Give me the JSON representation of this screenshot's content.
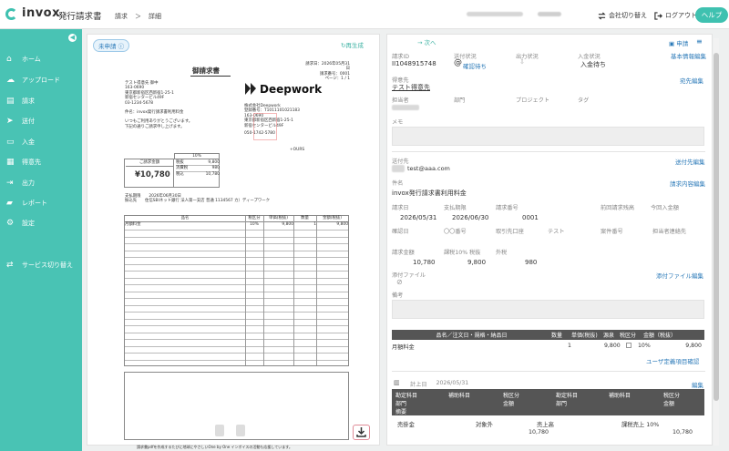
{
  "header": {
    "logo": "invox",
    "subtitle": "発行請求書",
    "breadcrumb": [
      "請求",
      "＞",
      "詳細"
    ],
    "switch_company": "会社切り替え",
    "logout": "ログアウト",
    "help": "ヘルプ"
  },
  "sidebar": {
    "items": [
      {
        "label": "ホーム",
        "icon": "home-icon"
      },
      {
        "label": "アップロード",
        "icon": "cloud-upload-icon"
      },
      {
        "label": "請求",
        "icon": "document-icon"
      },
      {
        "label": "送付",
        "icon": "paper-plane-icon"
      },
      {
        "label": "入金",
        "icon": "wallet-icon"
      },
      {
        "label": "得意先",
        "icon": "building-icon"
      },
      {
        "label": "出力",
        "icon": "export-icon"
      },
      {
        "label": "レポート",
        "icon": "chart-icon"
      },
      {
        "label": "設定",
        "icon": "gear-icon"
      },
      {
        "label": "サービス切り替え",
        "icon": "switch-icon"
      }
    ]
  },
  "doc": {
    "status": "未申請",
    "regenerate": "再生成",
    "title": "御請求書",
    "issue_date": "請求日：2026年05月31日",
    "number": "請求番号：0001",
    "page": "ページ：1 / 1",
    "to_name": "テスト得意先 御中",
    "to_zip": "163-0690",
    "to_addr1": "東京都新宿区西新宿1-25-1",
    "to_addr2": "新宿センタービル49F",
    "to_tel": "03-1234-5678",
    "subject": "件名：invox発行請求書利用料金",
    "greeting1": "いつもご利用ありがとうございます。",
    "greeting2": "下記の通りご請求申し上げます。",
    "brand": "Deepwork",
    "issuer": [
      "株式会社Deepwork",
      "登録番号：T1011101021183",
      "163-0690",
      "東京都新宿区西新宿1-25-1",
      "新宿センタービル49F",
      "050-1742-5780"
    ],
    "tax_rate": "10%",
    "amount_label": "ご請求金額",
    "amount": "¥10,780",
    "tax_rows": [
      [
        "税抜",
        "9,800"
      ],
      [
        "消費税",
        "980"
      ],
      [
        "税込",
        "10,780"
      ]
    ],
    "due": "支払期限",
    "due_date": "2026年06月30日",
    "bank_label": "振込先",
    "bank": "住信SBIネット銀行 法人第一支店 普通 1134567 カ）ディープワーク",
    "cols": [
      "品名",
      "税区分",
      "単価(税抜)",
      "数量",
      "金額(税抜)"
    ],
    "item": [
      "月額料金",
      "10%",
      "9,800",
      "1",
      "9,800"
    ],
    "footer_note": "請求書pdfを作成するたびに地球にやさしいOne by One インボイスの活動も応援しています。"
  },
  "right": {
    "next": "次へ",
    "apply": "申請",
    "fields1_labels": [
      "請求ID",
      "送付状況",
      "出力状況",
      "入金状況"
    ],
    "invoice_id": "II1048915748",
    "send_status": "確認待ち",
    "deposit_status": "入金待ち",
    "basic_edit": "基本情報編集",
    "customer_label": "得意先",
    "customer": "テスト得意先",
    "dest_edit": "宛先編集",
    "row2_labels": [
      "担当者",
      "部門",
      "プロジェクト",
      "タグ"
    ],
    "memo_label": "メモ",
    "send_to_label": "送付先",
    "send_edit": "送付先編集",
    "email": "test@aaa.com",
    "subject_label": "件名",
    "subject": "invox発行請求書利用料金",
    "content_edit": "請求内容編集",
    "r3_labels": [
      "請求日",
      "支払期限",
      "請求番号",
      "前回請求残高",
      "今回入金額"
    ],
    "r3_vals": [
      "2026/05/31",
      "2026/06/30",
      "0001"
    ],
    "r4_labels": [
      "確認日",
      "〇〇番号",
      "取引先口座",
      "テスト",
      "案件番号",
      "担当者連絡先"
    ],
    "r5_labels": [
      "請求金額",
      "課税10% 税抜",
      "外税"
    ],
    "r5_vals": [
      "10,780",
      "9,800",
      "980"
    ],
    "attach_label": "添付ファイル",
    "attach_edit": "添付ファイル編集",
    "notes_label": "備考",
    "table_cols": [
      "品名／注文日・規格・納品日",
      "数量",
      "単価(税抜)",
      "源泉",
      "税区分",
      "金額（税抜）"
    ],
    "table_row": [
      "月額料金",
      "1",
      "9,800",
      "",
      "10%",
      "9,800"
    ],
    "user_def": "ユーザ定義項目確認",
    "journal_label": "計上日",
    "journal_date": "2026/05/31",
    "journal_edit": "編集",
    "j_cols_left": [
      "勘定科目",
      "補助科目",
      "税区分"
    ],
    "j_cols_left2": [
      "部門",
      "金額"
    ],
    "j_cols_left3": [
      "摘要"
    ],
    "j_cols_right": [
      "勘定科目",
      "補助科目",
      "税区分"
    ],
    "j_cols_right2": [
      "部門",
      "金額"
    ],
    "j_row": [
      "売掛金",
      "対象外",
      "売上高",
      "課税売上 10%"
    ],
    "j_amt": [
      "10,780",
      "10,780"
    ]
  }
}
